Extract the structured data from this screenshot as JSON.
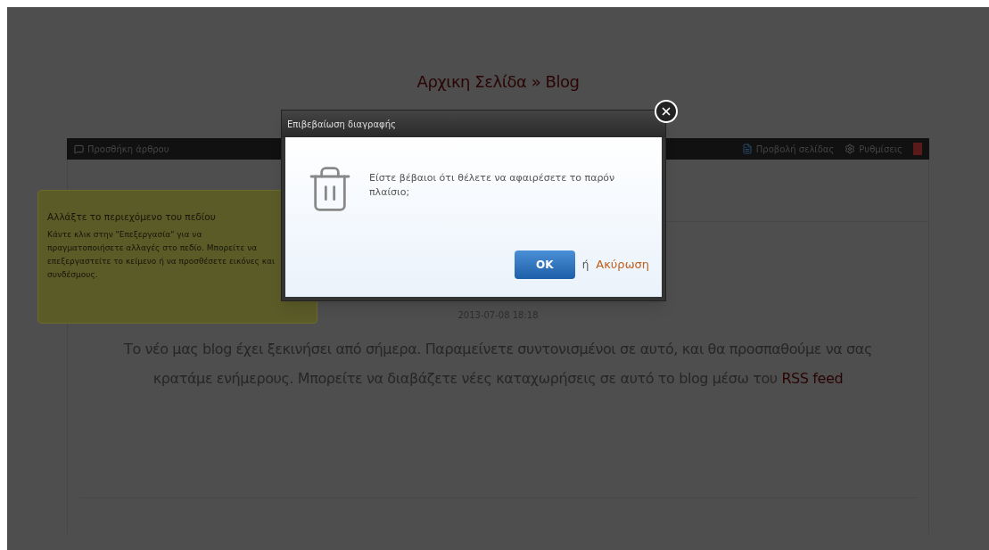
{
  "breadcrumb": "Αρχικη Σελίδα » Blog",
  "toolbar": {
    "left": "Προσθήκη άρθρου",
    "right": [
      "Προβολή σελίδας",
      "Ρυθμίσεις"
    ]
  },
  "tooltip": {
    "title": "Αλλάξτε το περιεχόμενο του πεδίου",
    "text": "Κάντε κλικ στην \"Επεξεργασία\" για να πραγματοποιήσετε αλλαγές στο πεδίο. Μπορείτε να επεξεργαστείτε το κείμενο ή να προσθέσετε εικόνες και συνδέσμους."
  },
  "post": {
    "date": "2013-07-08 18:18",
    "text": "Το νέο μας blog έχει ξεκινήσει από σήμερα. Παραμείνετε συντονισμένοι σε αυτό, και θα προσπαθούμε να σας κρατάμε ενήμερους. Μπορείτε να διαβάζετε νέες καταχωρήσεις σε αυτό το blog μέσω του",
    "link": "RSS feed"
  },
  "dialog": {
    "title": "Επιβεβαίωση διαγραφής",
    "message": "Είστε βέβαιοι ότι θέλετε να αφαιρέσετε το παρόν πλαίσιο;",
    "ok": "OK",
    "or": "ή",
    "cancel": "Ακύρωση"
  }
}
